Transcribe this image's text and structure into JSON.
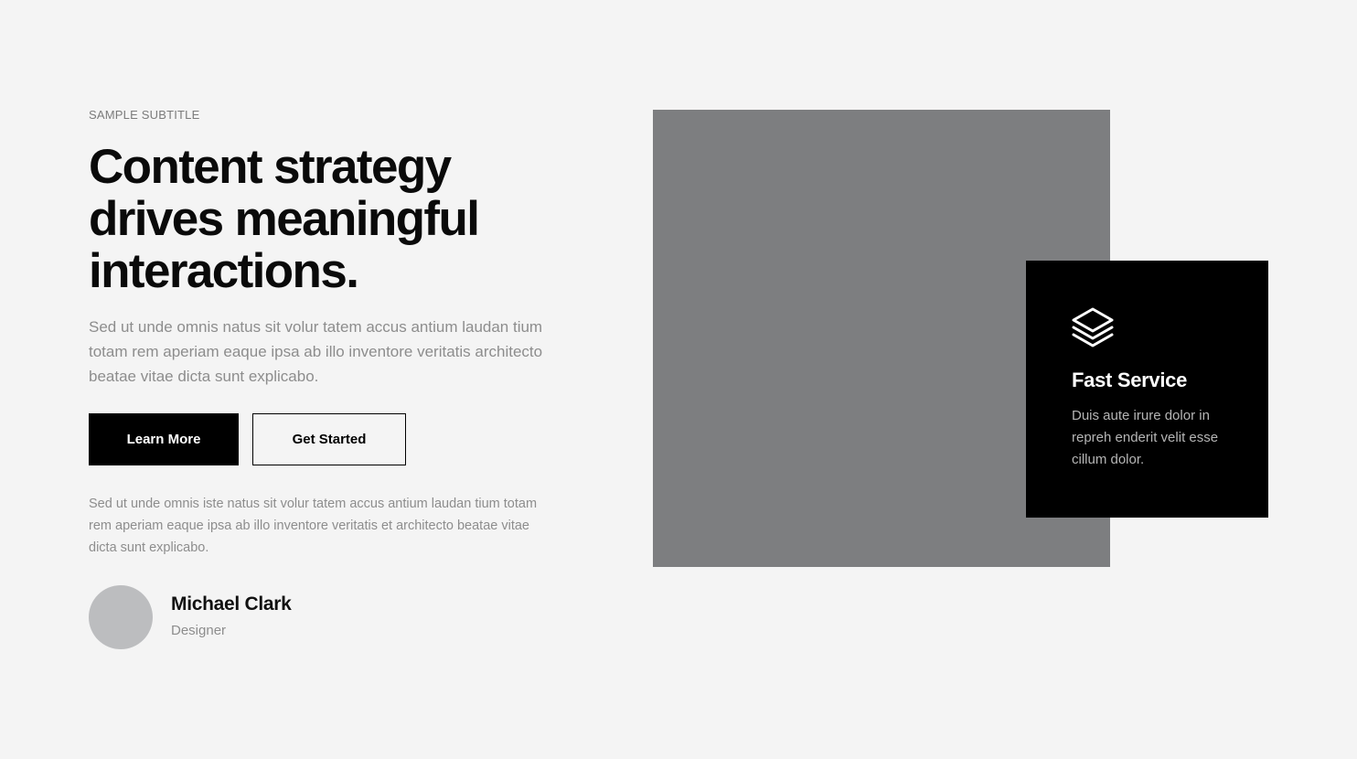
{
  "hero": {
    "subtitle": "SAMPLE SUBTITLE",
    "headline": "Content strategy drives meaningful interactions.",
    "lead": "Sed ut unde omnis natus sit volur tatem accus antium laudan tium totam rem aperiam eaque ipsa ab illo inventore veritatis architecto beatae vitae dicta sunt explicabo.",
    "primary_button": "Learn More",
    "secondary_button": "Get Started",
    "body": "Sed ut unde omnis iste natus sit volur tatem accus antium laudan tium totam rem aperiam eaque ipsa ab illo inventore veritatis et architecto beatae vitae dicta sunt explicabo."
  },
  "author": {
    "name": "Michael Clark",
    "role": "Designer"
  },
  "feature_card": {
    "icon": "layers-icon",
    "title": "Fast Service",
    "text": "Duis aute irure dolor in repreh enderit velit esse cillum dolor."
  },
  "colors": {
    "background": "#f4f4f4",
    "image_placeholder": "#7d7e80",
    "card_background": "#000000",
    "avatar": "#bcbdbf",
    "muted_text": "#8d8d8d"
  }
}
